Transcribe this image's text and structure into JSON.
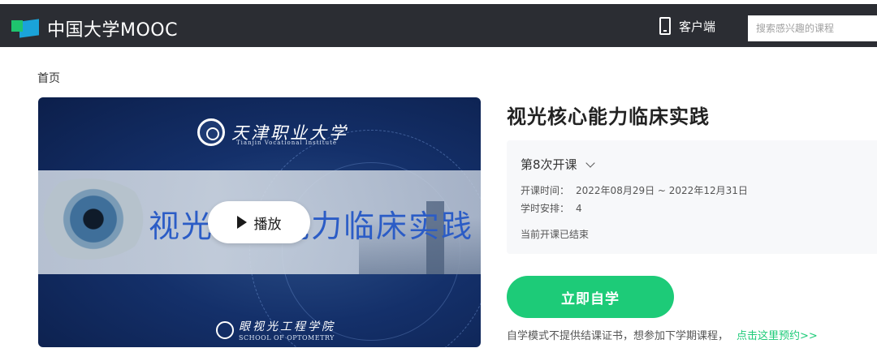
{
  "header": {
    "logo_text": "中国大学MOOC",
    "client_label": "客户端",
    "search_placeholder": "搜索感兴趣的课程"
  },
  "breadcrumb": "首页",
  "video": {
    "university_name": "天津职业大学",
    "university_en": "Tianjin Vocational Institute",
    "poster_title": "视光核心能力临床实践",
    "school_name": "眼视光工程学院",
    "school_en": "SCHOOL OF OPTOMETRY",
    "play_label": "播放"
  },
  "course": {
    "title": "视光核心能力临床实践",
    "term_label": "第8次开课",
    "open_time_label": "开课时间：",
    "open_time_value": "2022年08月29日 ~ 2022年12月31日",
    "hours_label": "学时安排：",
    "hours_value": "4",
    "status": "当前开课已结束",
    "study_button": "立即自学",
    "notice_text": "自学模式不提供结课证书，想参加下学期课程，",
    "notice_link": "点击这里预约>>"
  },
  "colors": {
    "topbar": "#2b2d33",
    "accent_green": "#1dcb78",
    "panel_bg": "#f7f8fa"
  }
}
